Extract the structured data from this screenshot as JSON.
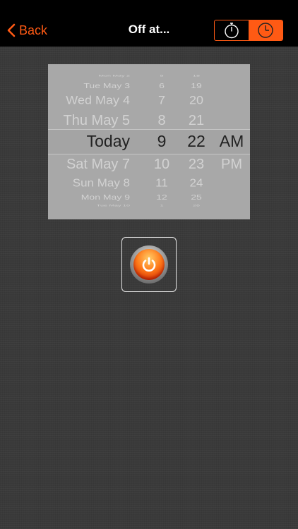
{
  "nav": {
    "back_label": "Back",
    "title": "Off at...",
    "segments": [
      {
        "icon": "stopwatch-icon",
        "selected": false
      },
      {
        "icon": "clock-icon",
        "selected": true
      }
    ],
    "accent_color": "#ff5a14"
  },
  "picker": {
    "date_rows": [
      "Mon May 2",
      "Tue May 3",
      "Wed May 4",
      "Thu May 5",
      "Today",
      "Sat May 7",
      "Sun May 8",
      "Mon May 9",
      "Tue May 10"
    ],
    "hour_rows": [
      "5",
      "6",
      "7",
      "8",
      "9",
      "10",
      "11",
      "12",
      "1"
    ],
    "minute_rows": [
      "18",
      "19",
      "20",
      "21",
      "22",
      "23",
      "24",
      "25",
      "26"
    ],
    "ampm_rows": [
      "AM",
      "PM"
    ],
    "selected": {
      "date": "Today",
      "hour": "9",
      "minute": "22",
      "ampm": "AM"
    }
  },
  "power_button": {
    "icon": "power-icon"
  }
}
